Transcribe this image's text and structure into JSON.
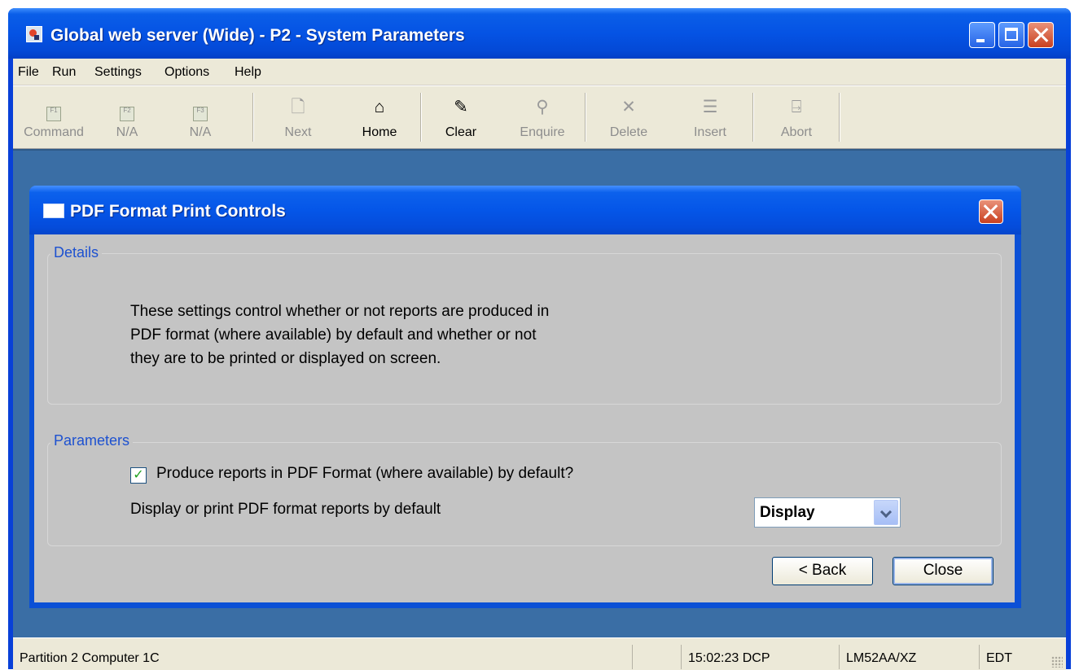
{
  "window": {
    "title": "Global web server (Wide) - P2 - System Parameters"
  },
  "menu": [
    "File",
    "Run",
    "Settings",
    "Options",
    "Help"
  ],
  "toolbar": {
    "command": "Command",
    "f2": "N/A",
    "f3": "N/A",
    "next": "Next",
    "home": "Home",
    "clear": "Clear",
    "enquire": "Enquire",
    "delete": "Delete",
    "insert": "Insert",
    "abort": "Abort",
    "icons": [
      "f1-key-icon",
      "f2-key-icon",
      "f3-key-icon",
      "next-page-icon",
      "home-icon",
      "clear-icon",
      "search-icon",
      "delete-icon",
      "insert-icon",
      "abort-icon"
    ]
  },
  "dialog": {
    "title": "PDF Format Print Controls",
    "details_label": "Details",
    "details_lines": [
      "These settings control whether or not reports are produced in",
      "PDF format (where available) by default and whether or not",
      "they are to be printed or displayed on screen."
    ],
    "parameters_label": "Parameters",
    "checkbox_label": "Produce reports in PDF Format (where available) by default?",
    "checkbox_checked": true,
    "select_label": "Display or print PDF format reports by default",
    "select_value": "Display",
    "back_label": "< Back",
    "close_label": "Close"
  },
  "status": {
    "partition": "Partition 2 Computer 1C",
    "time": "15:02:23",
    "mode": "DCP",
    "user": "LM52AA/XZ",
    "edit": "EDT"
  }
}
